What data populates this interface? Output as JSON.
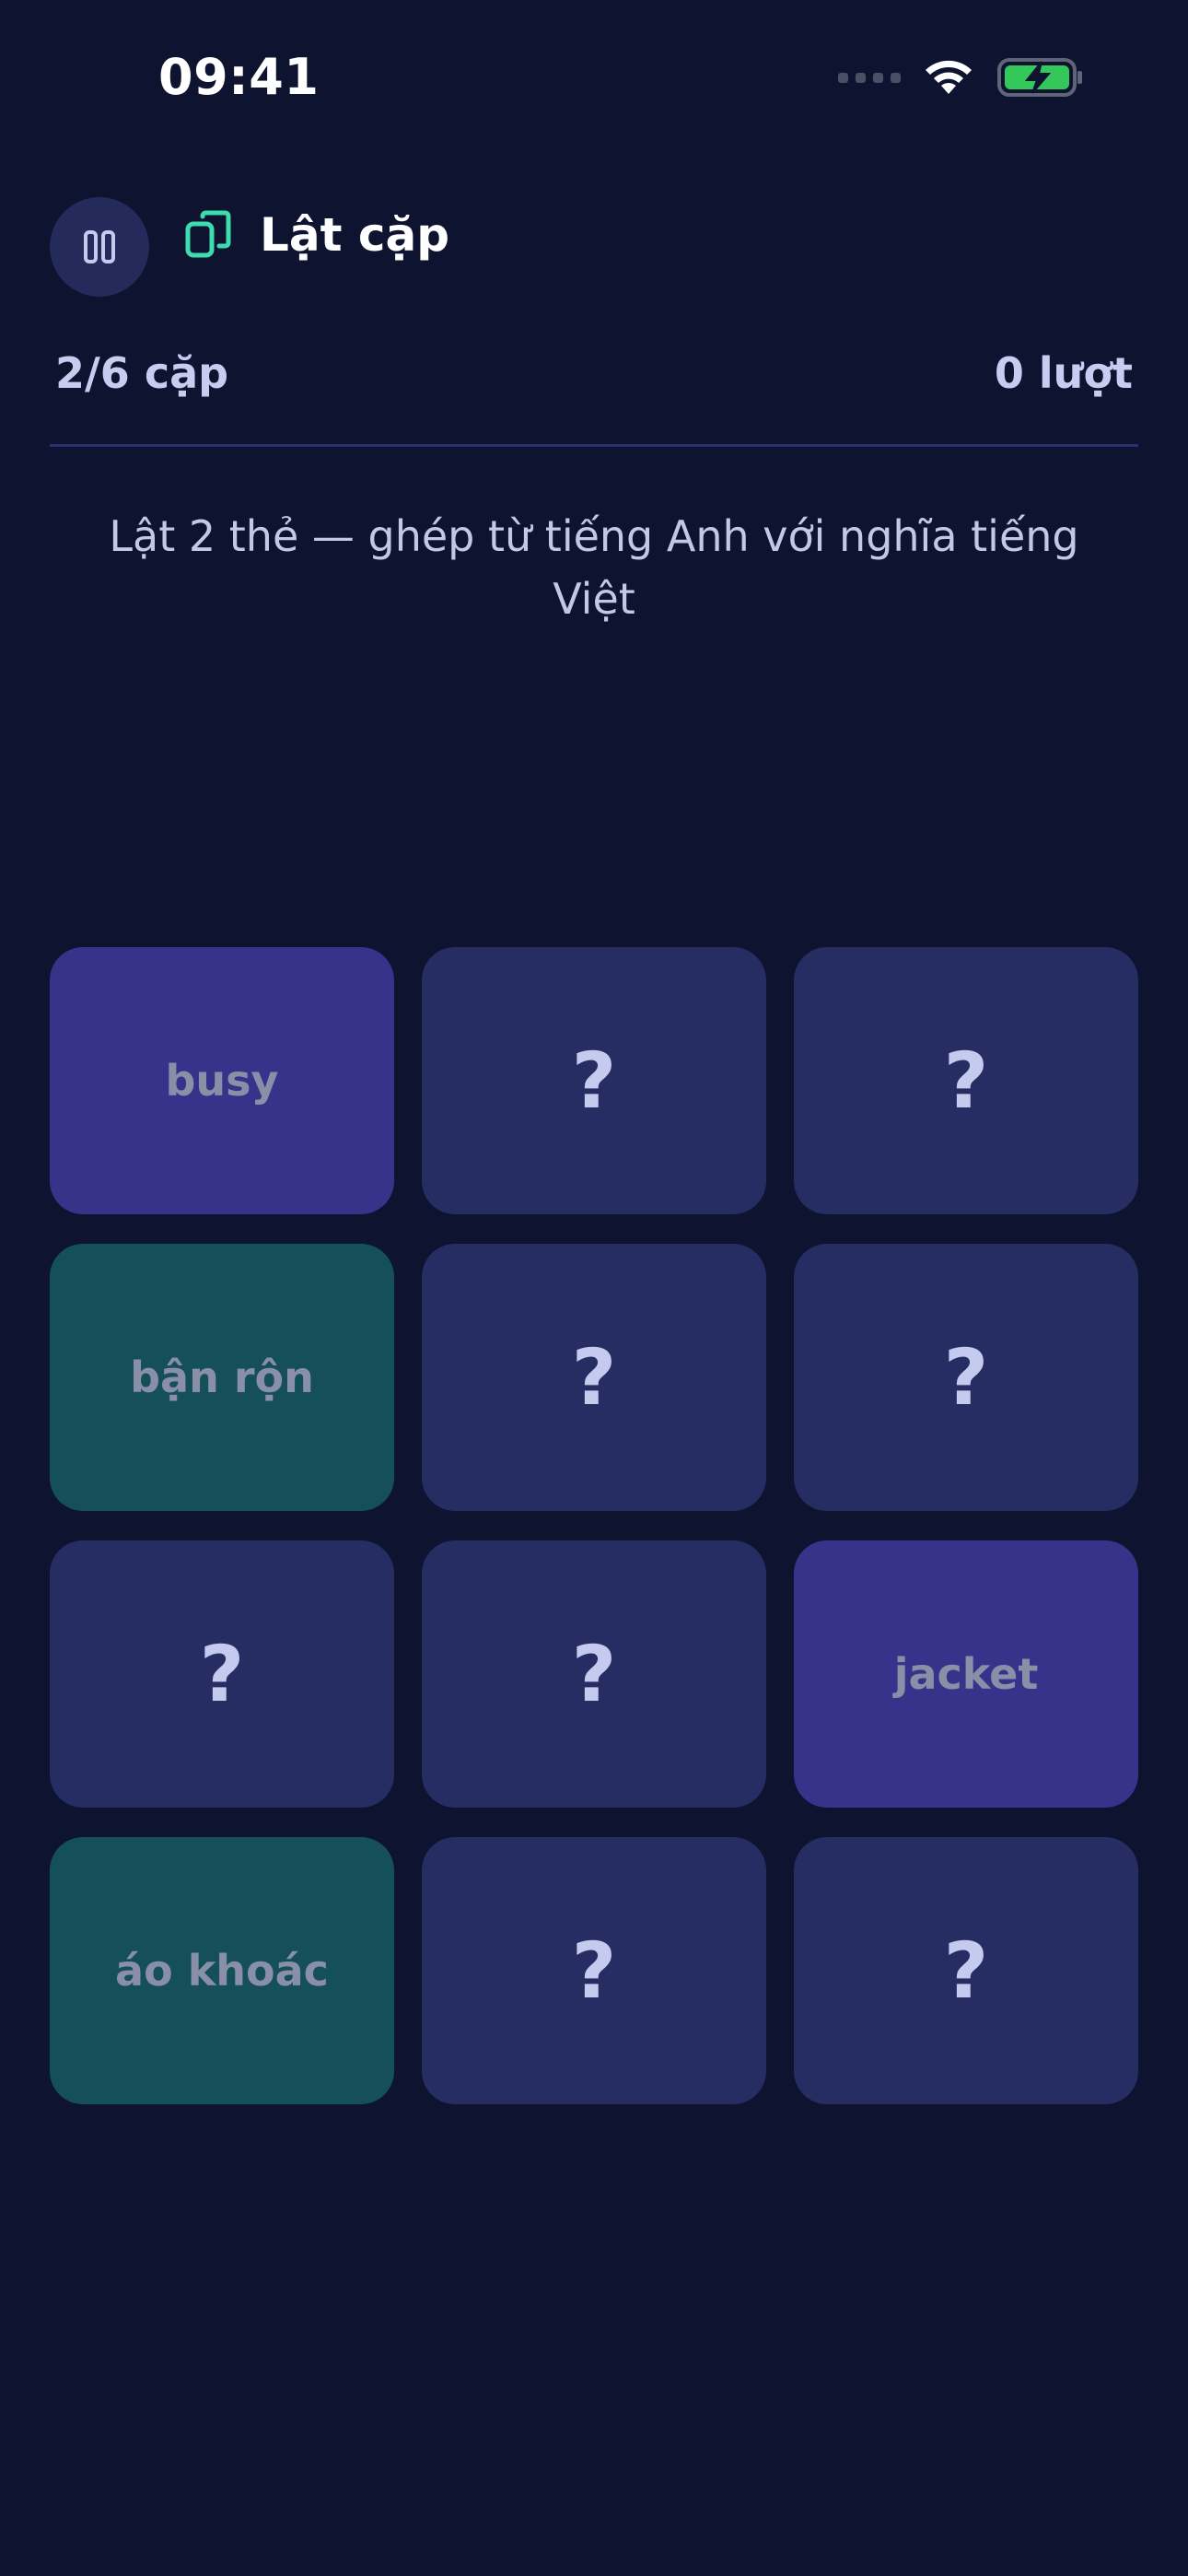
{
  "status_bar": {
    "time": "09:41",
    "icons": [
      "cellular-signal-icon",
      "wifi-icon",
      "battery-charging-icon"
    ],
    "battery_color": "#34c759"
  },
  "header": {
    "pause_icon": "pause-icon",
    "game_icon": "cards-icon",
    "title": "Lật cặp",
    "accent_color": "#3ddbb0"
  },
  "progress": {
    "pairs": "2/6 cặp",
    "turns": "0 lượt"
  },
  "instructions": "Lật 2 thẻ — ghép từ tiếng Anh với nghĩa tiếng Việt",
  "cards": [
    {
      "state": "word",
      "label": "busy"
    },
    {
      "state": "hidden",
      "label": "?"
    },
    {
      "state": "hidden",
      "label": "?"
    },
    {
      "state": "meaning",
      "label": "bận rộn"
    },
    {
      "state": "hidden",
      "label": "?"
    },
    {
      "state": "hidden",
      "label": "?"
    },
    {
      "state": "hidden",
      "label": "?"
    },
    {
      "state": "hidden",
      "label": "?"
    },
    {
      "state": "word",
      "label": "jacket"
    },
    {
      "state": "meaning",
      "label": "áo khoác"
    },
    {
      "state": "hidden",
      "label": "?"
    },
    {
      "state": "hidden",
      "label": "?"
    }
  ],
  "colors": {
    "background": "#0e1330",
    "card_hidden": "#262d62",
    "card_word_matched": "#37338a",
    "card_meaning_matched": "#15505a"
  }
}
